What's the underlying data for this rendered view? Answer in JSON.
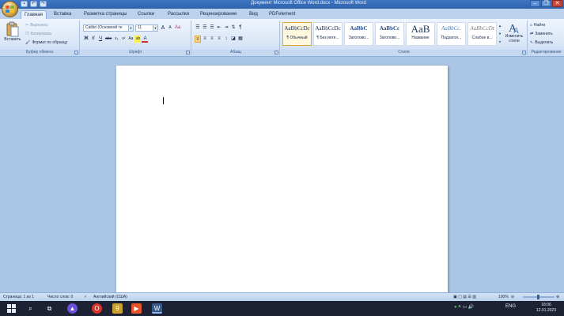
{
  "window": {
    "title": "Документ Microsoft Office Word.docx - Microsoft Word",
    "controls": [
      "–",
      "❐",
      "✕"
    ]
  },
  "qat_icons": [
    "save-icon",
    "undo-icon",
    "redo-icon"
  ],
  "tabs": [
    "Главная",
    "Вставка",
    "Разметка страницы",
    "Ссылки",
    "Рассылки",
    "Рецензирование",
    "Вид",
    "PDFelement"
  ],
  "active_tab": "Главная",
  "clipboard": {
    "paste": "Вставить",
    "cut": "Вырезать",
    "copy": "Копировать",
    "format_painter": "Формат по образцу",
    "label": "Буфер обмена"
  },
  "font": {
    "name": "Calibri (Основной те",
    "size": "11",
    "grow": "A",
    "shrink": "A",
    "clear": "Aa",
    "bold": "Ж",
    "italic": "К",
    "underline": "Ч",
    "strike": "abe",
    "subscript": "x₂",
    "superscript": "x²",
    "change_case": "Aa",
    "highlight": "ab",
    "font_color": "A",
    "label": "Шрифт"
  },
  "paragraph": {
    "label": "Абзац",
    "pilcrow": "¶"
  },
  "styles": {
    "label": "Стили",
    "items": [
      {
        "sample": "AaBbCcDc",
        "name": "¶ Обычный"
      },
      {
        "sample": "AaBbCcDc",
        "name": "¶ Без инте..."
      },
      {
        "sample": "AaBbC",
        "name": "Заголово..."
      },
      {
        "sample": "AaBbCc",
        "name": "Заголово..."
      },
      {
        "sample": "AaB",
        "name": "Название"
      },
      {
        "sample": "AaBbCc.",
        "name": "Подзагол..."
      },
      {
        "sample": "AaBbCcDt",
        "name": "Слабое в..."
      }
    ],
    "change_styles_line1": "Изменить",
    "change_styles_line2": "стили"
  },
  "editing": {
    "find": "Найти",
    "replace": "Заменить",
    "select": "Выделить",
    "label": "Редактирование"
  },
  "status": {
    "page": "Страница: 1 из 1",
    "words": "Число слов: 0",
    "language": "Английский (США)",
    "zoom": "100%"
  },
  "taskbar": {
    "lang": "ENG",
    "time": "18:06",
    "date": "12.01.2023"
  },
  "colors": {
    "ribbon_bg": "#dce8f7",
    "workspace_bg": "#abc5e5",
    "taskbar_bg": "#1c2133",
    "accent": "#e0a63a"
  }
}
